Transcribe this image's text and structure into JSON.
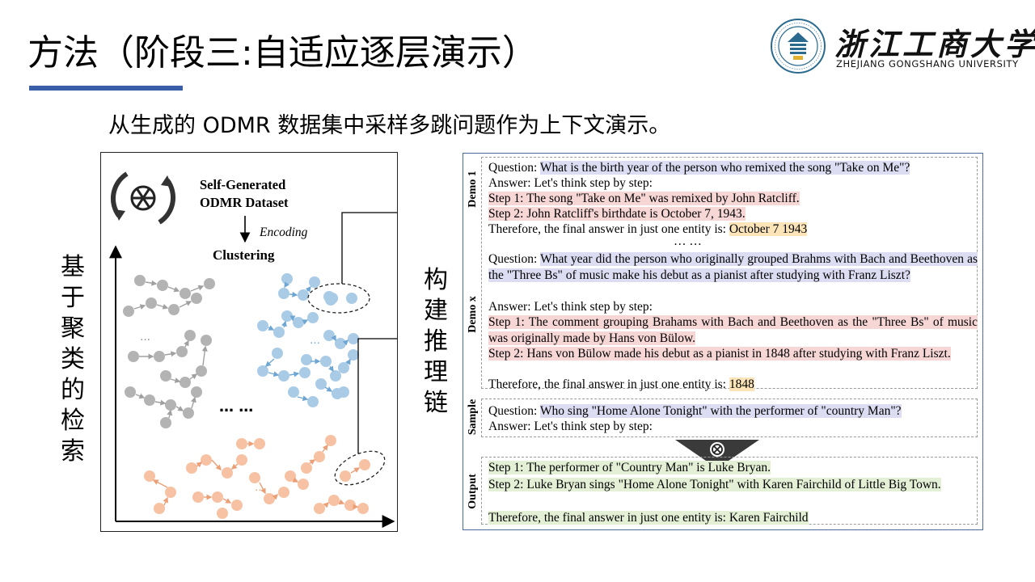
{
  "header": {
    "title": "方法（阶段三:自适应逐层演示）",
    "subtitle": "从生成的 ODMR 数据集中采样多跳问题作为上下文演示。"
  },
  "logo": {
    "name_cn": "浙江工商大学",
    "name_en": "ZHEJIANG  GONGSHANG  UNIVERSITY",
    "seal_text": "ZHEJIANG GONGSHANG UNIVERSITY"
  },
  "left_panel": {
    "vertical_label": [
      "基",
      "于",
      "聚",
      "类",
      "的",
      "检",
      "索"
    ],
    "dataset_label_line1": "Self-Generated",
    "dataset_label_line2": "ODMR Dataset",
    "encoding_label": "Encoding",
    "clustering_label": "Clustering",
    "ellipsis": "… …",
    "small_ellipsis": "…",
    "colors": {
      "gray": "#b3b3b3",
      "blue": "#a9cbe6",
      "orange": "#f6c2a3",
      "arrow_gray": "#a0a0a0",
      "arrow_blue": "#6fa7d4",
      "arrow_orange": "#eb9f76"
    }
  },
  "middle_label": [
    "构",
    "建",
    "推",
    "理",
    "链"
  ],
  "right_panel": {
    "demo1": {
      "label": "Demo 1",
      "question_prefix": "Question: ",
      "question": "What is the birth year of the person who remixed the song \"Take on Me\"?",
      "answer_intro": "Answer: Let's think step by step:",
      "step1": "Step 1: The song \"Take on Me\" was remixed by John Ratcliff.",
      "step2": "Step 2: John Ratcliff's birthdate is October 7, 1943.",
      "final_prefix": "Therefore, the final answer in just one entity is: ",
      "final_answer": "October 7 1943"
    },
    "ellipsis": "… …",
    "demox": {
      "label": "Demo x",
      "question_prefix": "Question: ",
      "question": "What year did the person who originally grouped Brahms with Bach and Beethoven as the \"Three Bs\" of music make his debut as a pianist after studying with Franz Liszt?",
      "answer_intro": "Answer: Let's think step by step:",
      "step1": "Step 1: The comment grouping Brahams with Bach and Beethoven as the \"Three Bs\" of music was originally made by Hans von Bülow.",
      "step2": "Step 2: Hans von Bülow made his debut as a pianist in 1848 after studying with Franz Liszt.",
      "final_prefix": "Therefore, the final answer in just one entity is: ",
      "final_answer": "1848"
    },
    "sample": {
      "label": "Sample",
      "question_prefix": "Question: ",
      "question": "Who sing \"Home Alone Tonight\" with the performer of \"country Man\"?",
      "answer_intro": "Answer: Let's think step by step:"
    },
    "output": {
      "label": "Output",
      "step1": "Step 1: The performer of \"Country Man\" is Luke Bryan.",
      "step2": "Step 2: Luke Bryan sings \"Home Alone Tonight\" with Karen Fairchild of Little Big Town.",
      "final": "Therefore, the final answer in just one entity is: Karen Fairchild"
    },
    "colors": {
      "question": "#dcdcf2",
      "step": "#f7d7d6",
      "answer": "#fbe4b8",
      "output": "#e3f0d6"
    }
  }
}
